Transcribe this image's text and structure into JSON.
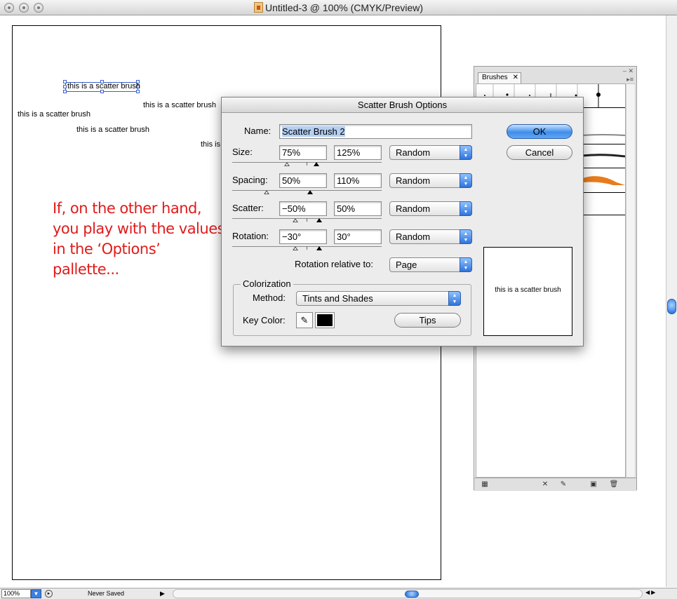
{
  "window": {
    "title": "Untitled-3 @ 100% (CMYK/Preview)"
  },
  "artboard": {
    "scatter_texts": [
      "this is a scatter brush",
      "this is a scatter brush",
      "this is a scatter brush",
      "this is a scatter brush",
      "this is"
    ]
  },
  "annotation": {
    "text": "If, on the other hand, you play with the values in the ‘Options’ pallette..."
  },
  "status": {
    "zoom": "100%",
    "doc_status": "Never Saved"
  },
  "brushes_panel": {
    "tab_label": "Brushes"
  },
  "dialog": {
    "title": "Scatter Brush Options",
    "name_label": "Name:",
    "name_value": "Scatter Brush 2",
    "ok_label": "OK",
    "cancel_label": "Cancel",
    "rows": [
      {
        "label": "Size:",
        "min": "75%",
        "max": "125%",
        "mode": "Random"
      },
      {
        "label": "Spacing:",
        "min": "50%",
        "max": "110%",
        "mode": "Random"
      },
      {
        "label": "Scatter:",
        "min": "−50%",
        "max": "50%",
        "mode": "Random"
      },
      {
        "label": "Rotation:",
        "min": "−30°",
        "max": "30°",
        "mode": "Random"
      }
    ],
    "rotation_relative_label": "Rotation relative to:",
    "rotation_relative_value": "Page",
    "colorization": {
      "group_title": "Colorization",
      "method_label": "Method:",
      "method_value": "Tints and Shades",
      "key_color_label": "Key Color:",
      "key_color": "#000000",
      "tips_label": "Tips"
    },
    "preview_text": "this is a scatter brush"
  }
}
